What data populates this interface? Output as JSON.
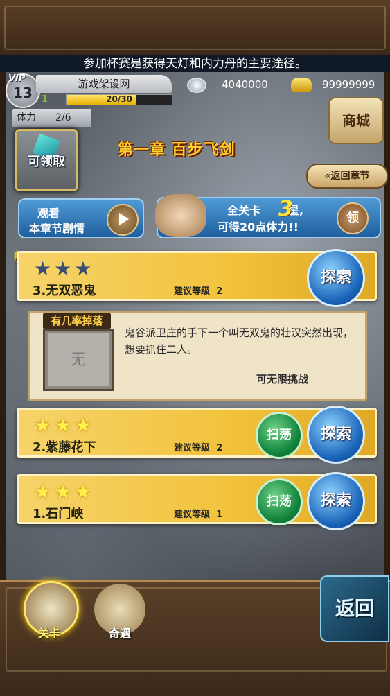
{
  "notice": "参加杯赛是获得天灯和内力丹的主要途径。",
  "player": {
    "vip_label": "VIP",
    "vip_level": "13",
    "name": "游戏架设网",
    "level": "1",
    "exp": "20/30",
    "exp_fraction": 0.6667,
    "silver": "4040000",
    "gold": "99999999"
  },
  "stamina": {
    "label": "体力",
    "value": "2/6"
  },
  "claim_label": "可领取",
  "chapter_title": "第一章  百步飞剑",
  "shop_label": "商城",
  "back_chapter_label": "返回章节",
  "story_button": {
    "line1": "观看",
    "line2": "本章节剧情"
  },
  "reward_banner": {
    "line1": "全关卡",
    "count": "3",
    "line1_suffix": "星,",
    "line2": "可得20点体力!!",
    "claim": "领"
  },
  "new_badge": "新",
  "stages": [
    {
      "name": "3.无双恶鬼",
      "rec_label": "建议等级",
      "rec_level": "2",
      "stars": 0,
      "explore": "探索"
    },
    {
      "name": "2.紫藤花下",
      "rec_label": "建议等级",
      "rec_level": "2",
      "stars": 3,
      "explore": "探索",
      "sweep": "扫荡"
    },
    {
      "name": "1.石门峡",
      "rec_label": "建议等级",
      "rec_level": "1",
      "stars": 3,
      "explore": "探索",
      "sweep": "扫荡"
    }
  ],
  "detail": {
    "drop_label": "有几率掉落",
    "drop_none": "无",
    "description": "鬼谷派卫庄的手下一个叫无双鬼的壮汉突然出现，想要抓住二人。",
    "unlimited": "可无限挑战"
  },
  "nav": {
    "level_tab": "关卡",
    "adventure_tab": "奇遇",
    "return": "返回"
  },
  "colors": {
    "gold_text": "#ffcf2b",
    "stage_bg": "#f2c23b",
    "explore_blue": "#1a64b8",
    "sweep_green": "#11823b"
  }
}
